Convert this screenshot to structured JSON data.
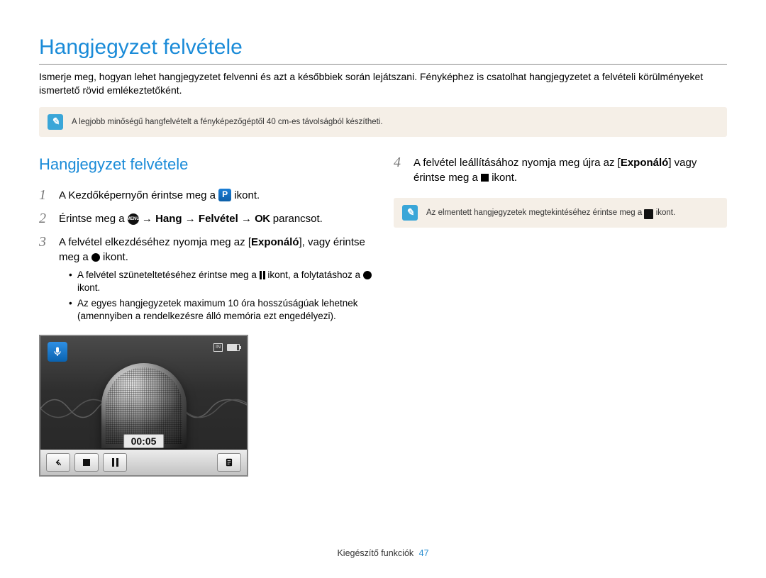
{
  "title": "Hangjegyzet felvétele",
  "intro": "Ismerje meg, hogyan lehet hangjegyzetet felvenni és azt a későbbiek során lejátszani. Fényképhez is csatolhat hangjegyzetet a felvételi körülményeket ismertető rövid emlékeztetőként.",
  "tip1": "A legjobb minőségű hangfelvételt a fényképezőgéptől 40 cm-es távolságból készítheti.",
  "sub_heading": "Hangjegyzet felvétele",
  "steps": {
    "s1_a": "A Kezdőképernyőn érintse meg a ",
    "s1_b": " ikont.",
    "s2_a": "Érintse meg a ",
    "s2_b": " → ",
    "s2_hang": "Hang",
    "s2_c": " → ",
    "s2_felv": "Felvétel",
    "s2_d": " → ",
    "s2_ok": "OK",
    "s2_e": " parancsot.",
    "s3_a": "A felvétel elkezdéséhez nyomja meg az [",
    "s3_exp": "Exponáló",
    "s3_b": "], vagy érintse meg a ",
    "s3_c": " ikont.",
    "s4_a": "A felvétel leállításához nyomja meg újra az [",
    "s4_exp": "Exponáló",
    "s4_b": "] vagy érintse meg a ",
    "s4_c": " ikont."
  },
  "bullets": {
    "b1_a": "A felvétel szüneteltetéséhez érintse meg a ",
    "b1_b": " ikont, a folytatáshoz a ",
    "b1_c": " ikont.",
    "b2": "Az egyes hangjegyzetek maximum 10 óra hosszúságúak lehetnek (amennyiben a rendelkezésre álló memória ezt engedélyezi)."
  },
  "tip2_a": "Az elmentett hangjegyzetek megtekintéséhez érintse meg a ",
  "tip2_b": " ikont.",
  "recorder": {
    "timer": "00:05",
    "status_in": "IN"
  },
  "footer": {
    "label": "Kiegészítő funkciók",
    "page": "47"
  }
}
